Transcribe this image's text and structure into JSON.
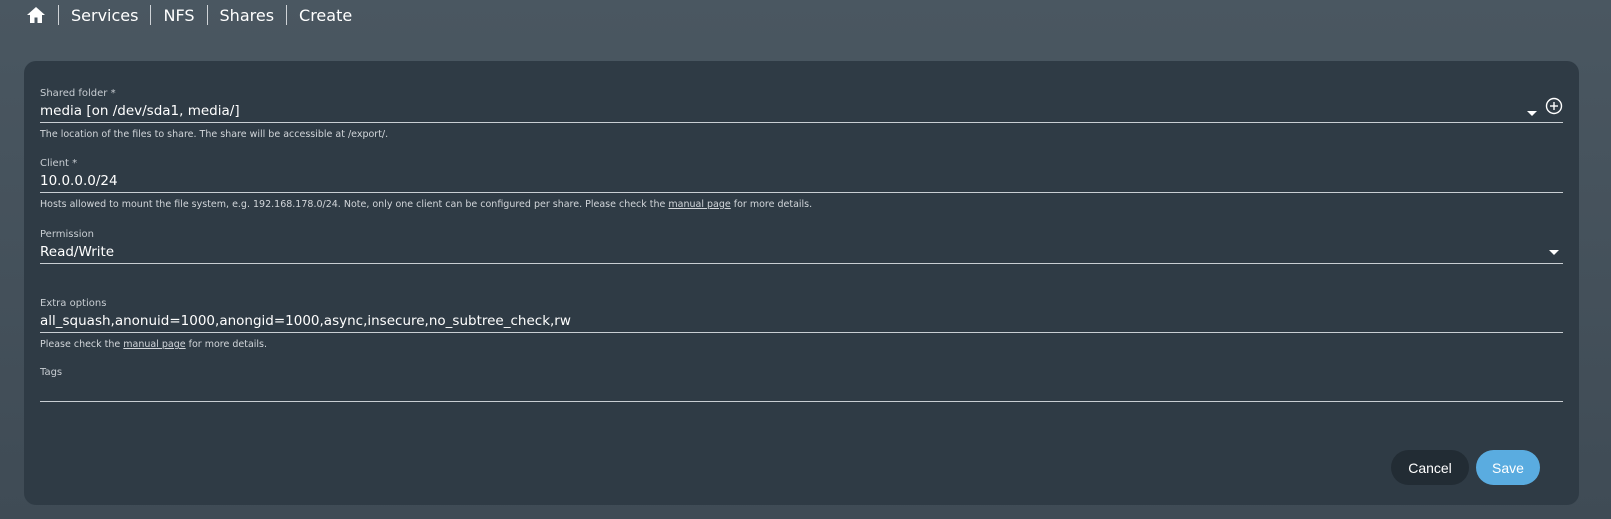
{
  "breadcrumb": {
    "home_icon": "home-icon",
    "items": [
      "Services",
      "NFS",
      "Shares",
      "Create"
    ]
  },
  "form": {
    "shared_folder": {
      "label": "Shared folder *",
      "value": "media [on /dev/sda1, media/]",
      "hint": "The location of the files to share. The share will be accessible at /export/."
    },
    "client": {
      "label": "Client *",
      "value": "10.0.0.0/24",
      "hint_before": "Hosts allowed to mount the file system, e.g. 192.168.178.0/24. Note, only one client can be configured per share. Please check the ",
      "hint_link": "manual page",
      "hint_after": " for more details."
    },
    "permission": {
      "label": "Permission",
      "value": "Read/Write"
    },
    "extra_options": {
      "label": "Extra options",
      "value": "all_squash,anonuid=1000,anongid=1000,async,insecure,no_subtree_check,rw",
      "hint_before": "Please check the ",
      "hint_link": "manual page",
      "hint_after": " for more details."
    },
    "tags": {
      "label": "Tags",
      "value": ""
    }
  },
  "actions": {
    "cancel_label": "Cancel",
    "save_label": "Save"
  },
  "colors": {
    "background": "#4a5761",
    "card": "#2f3b45",
    "cancel_button": "#222c34",
    "save_button": "#5aace0"
  }
}
